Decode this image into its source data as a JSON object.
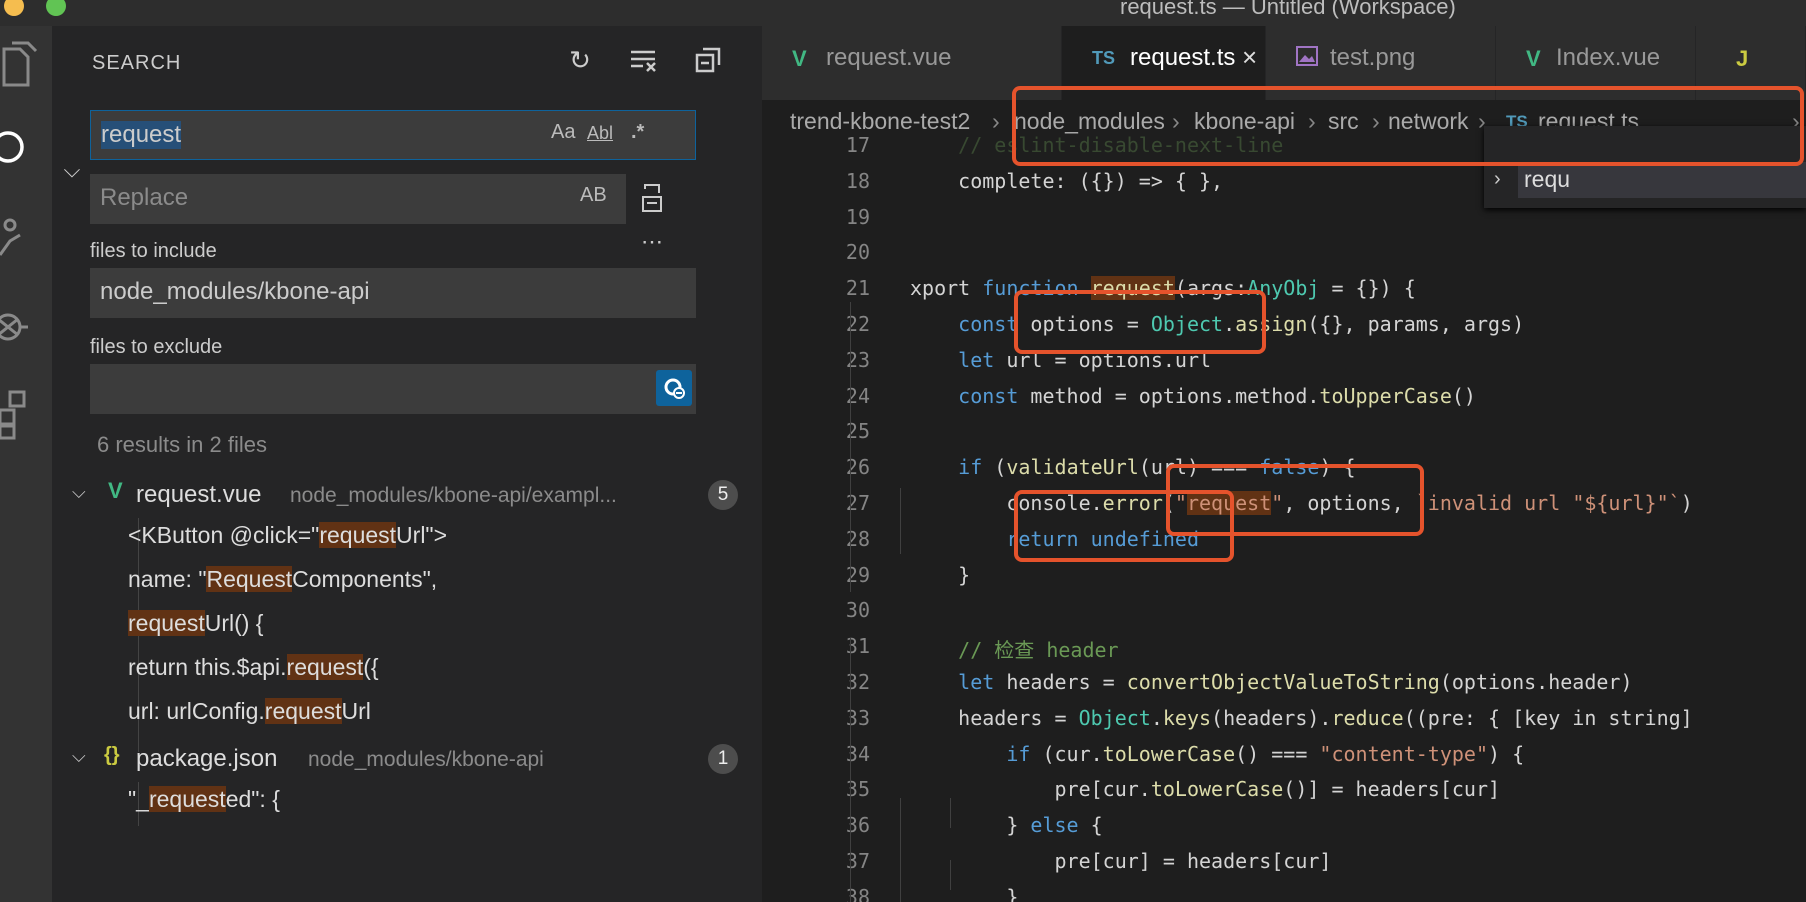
{
  "window": {
    "title": "request.ts — Untitled (Workspace)"
  },
  "activity_bar": {
    "icons": [
      "files-icon",
      "search-icon",
      "source-control-icon",
      "debug-icon",
      "extensions-icon"
    ]
  },
  "search": {
    "title": "SEARCH",
    "query": "request",
    "options": {
      "match_case": "Aa",
      "whole_word": "Abl",
      "regex": ".*"
    },
    "replace_placeholder": "Replace",
    "preserve_case": "AB",
    "include_label": "files to include",
    "include_value": "node_modules/kbone-api",
    "exclude_label": "files to exclude",
    "exclude_value": "",
    "summary": "6 results in 2 files",
    "results": [
      {
        "file": "request.vue",
        "path": "node_modules/kbone-api/exampl...",
        "count": "5",
        "matches": [
          [
            "<KButton @click=\"",
            "request",
            "Url\">"
          ],
          [
            "name: \"",
            "Request",
            "Components\","
          ],
          [
            "",
            "request",
            "Url() {"
          ],
          [
            "return this.$api.",
            "request",
            "({"
          ],
          [
            "url: urlConfig.",
            "request",
            "Url"
          ]
        ]
      },
      {
        "file": "package.json",
        "path": "node_modules/kbone-api",
        "count": "1",
        "matches": [
          [
            "\"_",
            "request",
            "ed\": {"
          ]
        ]
      }
    ]
  },
  "tabs": [
    {
      "label": "request.vue",
      "icon": "V",
      "active": false
    },
    {
      "label": "request.ts",
      "icon": "TS",
      "active": true
    },
    {
      "label": "test.png",
      "icon": "img",
      "active": false
    },
    {
      "label": "Index.vue",
      "icon": "V",
      "active": false
    }
  ],
  "breadcrumbs": [
    "trend-kbone-test2",
    "node_modules",
    "kbone-api",
    "src",
    "network",
    "request.ts"
  ],
  "peek_text": "requ",
  "line_numbers": [
    "17",
    "18",
    "19",
    "20",
    "21",
    "22",
    "23",
    "24",
    "25",
    "26",
    "27",
    "28",
    "29",
    "30",
    "31",
    "32",
    "33",
    "34",
    "35",
    "36",
    "37",
    "38"
  ],
  "code_lines": [
    "    // eslint-disable-next-line",
    "    complete: ({}) => { },",
    "",
    "",
    "xport function request(args:AnyObj = {}) {",
    "    const options = Object.assign({}, params, args)",
    "    let url = options.url",
    "    const method = options.method.toUpperCase()",
    "",
    "    if (validateUrl(url) === false) {",
    "        console.error(\"request\", options, `invalid url \"${url}\"`)",
    "        return undefined",
    "    }",
    "",
    "    // 检查 header",
    "    let headers = convertObjectValueToString(options.header)",
    "    headers = Object.keys(headers).reduce((pre: { [key in string]",
    "        if (cur.toLowerCase() === \"content-type\") {",
    "            pre[cur.toLowerCase()] = headers[cur]",
    "        } else {",
    "            pre[cur] = headers[cur]",
    "        }"
  ],
  "colors": {
    "highlight": "#613214",
    "annotation": "#e5532c",
    "vue": "#41b883",
    "ts": "#519aba"
  }
}
